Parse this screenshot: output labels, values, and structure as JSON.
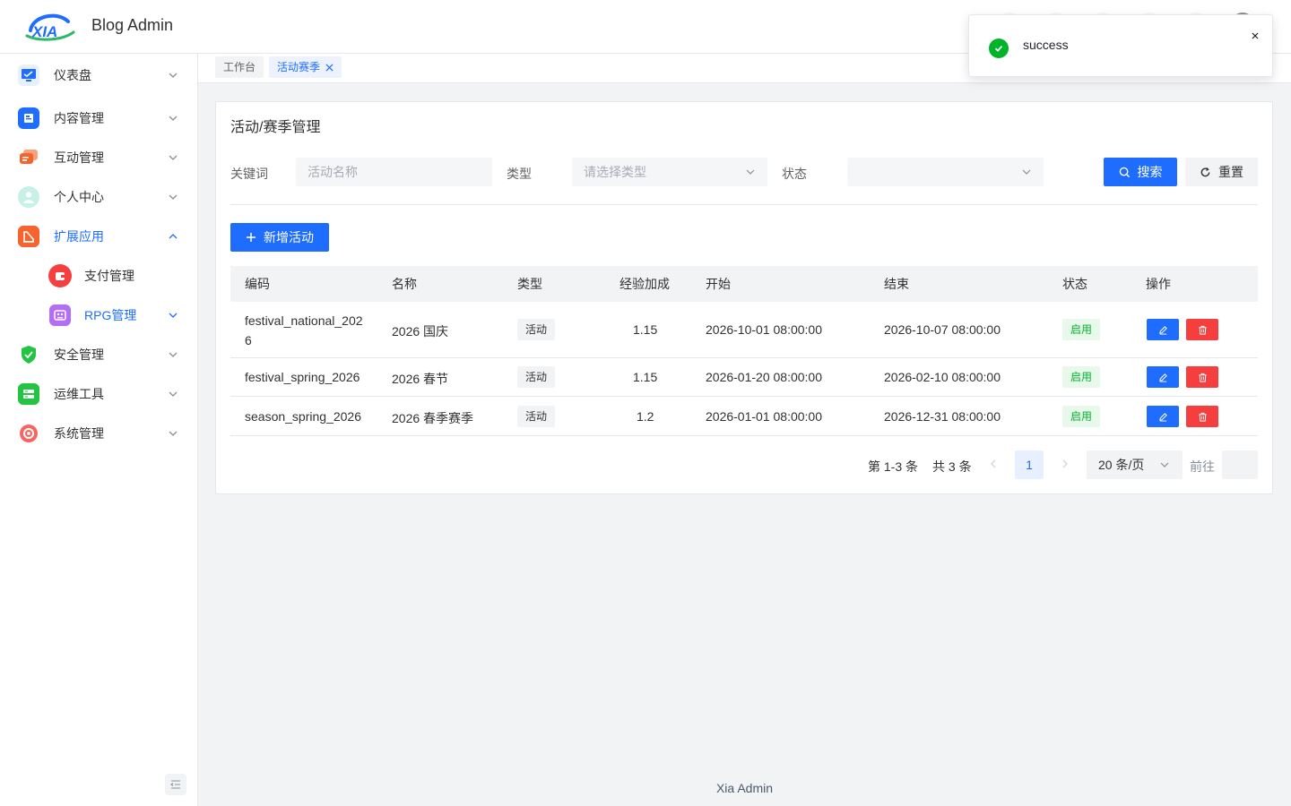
{
  "header": {
    "logo_text": "XIA",
    "brand": "Blog Admin"
  },
  "sidebar": {
    "items": [
      {
        "label": "仪表盘",
        "icon": "dashboard-icon"
      },
      {
        "label": "内容管理",
        "icon": "content-icon"
      },
      {
        "label": "互动管理",
        "icon": "interaction-icon"
      },
      {
        "label": "个人中心",
        "icon": "user-icon"
      },
      {
        "label": "扩展应用",
        "icon": "extension-icon",
        "expanded": true
      },
      {
        "label": "支付管理",
        "icon": "payment-icon",
        "sub": true
      },
      {
        "label": "RPG管理",
        "icon": "rpg-icon",
        "sub": true,
        "active": true
      },
      {
        "label": "安全管理",
        "icon": "shield-icon"
      },
      {
        "label": "运维工具",
        "icon": "ops-icon"
      },
      {
        "label": "系统管理",
        "icon": "system-icon"
      }
    ]
  },
  "tabs": [
    {
      "label": "工作台",
      "active": false
    },
    {
      "label": "活动赛季",
      "active": true
    }
  ],
  "page": {
    "title": "活动/赛季管理",
    "filters": {
      "keyword_label": "关键词",
      "keyword_placeholder": "活动名称",
      "type_label": "类型",
      "type_placeholder": "请选择类型",
      "status_label": "状态",
      "status_value": ""
    },
    "search_label": "搜索",
    "reset_label": "重置",
    "add_label": "新增活动"
  },
  "table": {
    "columns": [
      "编码",
      "名称",
      "类型",
      "经验加成",
      "开始",
      "结束",
      "状态",
      "操作"
    ],
    "rows": [
      {
        "code": "festival_national_2026",
        "code_line1": "festival_national_202",
        "code_line2": "6",
        "name": "2026 国庆",
        "type": "活动",
        "exp": "1.15",
        "start": "2026-10-01 08:00:00",
        "end": "2026-10-07 08:00:00",
        "status": "启用"
      },
      {
        "code": "festival_spring_2026",
        "name": "2026 春节",
        "type": "活动",
        "exp": "1.15",
        "start": "2026-01-20 08:00:00",
        "end": "2026-02-10 08:00:00",
        "status": "启用"
      },
      {
        "code": "season_spring_2026",
        "name": "2026 春季赛季",
        "type": "活动",
        "exp": "1.2",
        "start": "2026-01-01 08:00:00",
        "end": "2026-12-31 08:00:00",
        "status": "启用"
      }
    ]
  },
  "pagination": {
    "range": "第 1-3 条",
    "total": "共 3 条",
    "current_page": "1",
    "page_size": "20 条/页",
    "goto_label": "前往"
  },
  "footer": "Xia Admin",
  "toast": {
    "message": "success",
    "type": "success"
  },
  "colors": {
    "primary": "#1e6dff",
    "danger": "#f53f3f",
    "success": "#00b42a"
  }
}
